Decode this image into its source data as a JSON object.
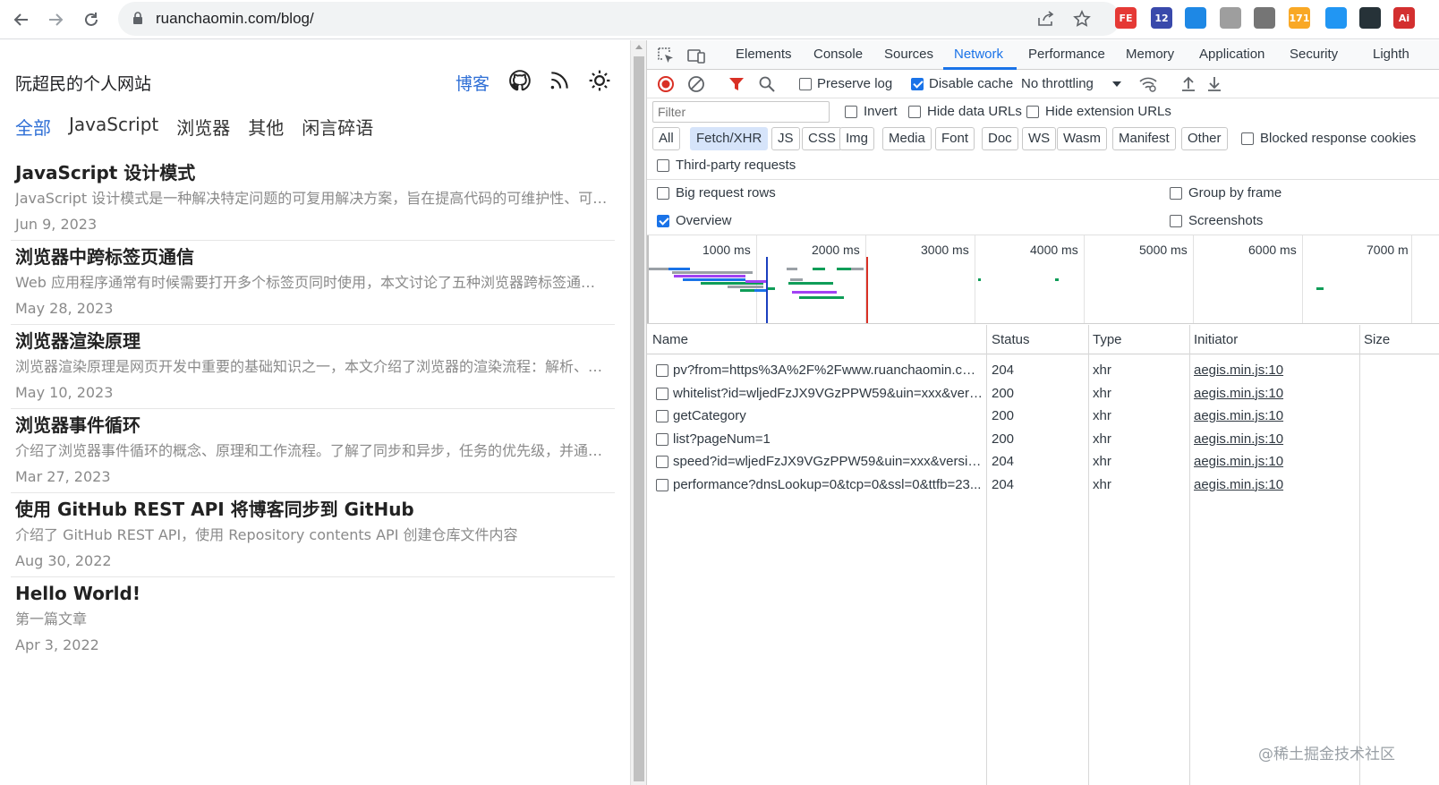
{
  "browser": {
    "url": "ruanchaomin.com/blog/",
    "extensions": [
      {
        "icon": "fe-extension-icon",
        "label": "FE",
        "color": "#e53935"
      },
      {
        "icon": "graduation-cap-extension-icon",
        "label": "12",
        "color": "#3949ab"
      },
      {
        "icon": "vue-devtools-extension-icon",
        "label": "",
        "color": "#1e88e5"
      },
      {
        "icon": "circle-extension-icon",
        "label": "",
        "color": "#9e9e9e"
      },
      {
        "icon": "v-extension-icon",
        "label": "",
        "color": "#757575"
      },
      {
        "icon": "rss-extension-icon",
        "label": "171",
        "color": "#f9a825"
      },
      {
        "icon": "stack-extension-icon",
        "label": "",
        "color": "#2196f3"
      },
      {
        "icon": "hexagon-extension-icon",
        "label": "",
        "color": "#263238"
      },
      {
        "icon": "ai-extension-icon",
        "label": "Ai",
        "color": "#d32f2f"
      }
    ]
  },
  "blog": {
    "site_title": "阮超民的个人网站",
    "nav_blog": "博客",
    "categories": [
      "全部",
      "JavaScript",
      "浏览器",
      "其他",
      "闲言碎语"
    ],
    "active_category": "全部",
    "posts": [
      {
        "title": "JavaScript 设计模式",
        "desc": "JavaScript 设计模式是一种解决特定问题的可复用解决方案，旨在提高代码的可维护性、可读...",
        "date": "Jun 9, 2023"
      },
      {
        "title": "浏览器中跨标签页通信",
        "desc": "Web 应用程序通常有时候需要打开多个标签页同时使用，本文讨论了五种浏览器跨标签通信方...",
        "date": "May 28, 2023"
      },
      {
        "title": "浏览器渲染原理",
        "desc": "浏览器渲染原理是网页开发中重要的基础知识之一，本文介绍了浏览器的渲染流程：解析、样...",
        "date": "May 10, 2023"
      },
      {
        "title": "浏览器事件循环",
        "desc": "介绍了浏览器事件循环的概念、原理和工作流程。了解了同步和异步，任务的优先级，并通过...",
        "date": "Mar 27, 2023"
      },
      {
        "title": "使用 GitHub REST API 将博客同步到 GitHub",
        "desc": "介绍了 GitHub REST API，使用 Repository contents API 创建仓库文件内容",
        "date": "Aug 30, 2022"
      },
      {
        "title": "Hello World!",
        "desc": "第一篇文章",
        "date": "Apr 3, 2022"
      }
    ]
  },
  "devtools": {
    "tabs": [
      "Elements",
      "Console",
      "Sources",
      "Network",
      "Performance",
      "Memory",
      "Application",
      "Security",
      "Lighth"
    ],
    "active_tab": "Network",
    "toolbar": {
      "preserve_log": "Preserve log",
      "disable_cache": "Disable cache",
      "throttling": "No throttling"
    },
    "filter": {
      "placeholder": "Filter",
      "invert": "Invert",
      "hide_data_urls": "Hide data URLs",
      "hide_extension_urls": "Hide extension URLs"
    },
    "types": [
      "All",
      "Fetch/XHR",
      "JS",
      "CSS",
      "Img",
      "Media",
      "Font",
      "Doc",
      "WS",
      "Wasm",
      "Manifest",
      "Other"
    ],
    "active_type": "Fetch/XHR",
    "blocked_cookies": "Blocked response cookies",
    "third_party": "Third-party requests",
    "big_request_rows": "Big request rows",
    "group_by_frame": "Group by frame",
    "overview_label": "Overview",
    "screenshots": "Screenshots",
    "timeline_labels": [
      "1000 ms",
      "2000 ms",
      "3000 ms",
      "4000 ms",
      "5000 ms",
      "6000 ms",
      "7000 m"
    ],
    "columns": [
      "Name",
      "Status",
      "Type",
      "Initiator",
      "Size"
    ],
    "requests": [
      {
        "name": "pv?from=https%3A%2F%2Fwww.ruanchaomin.com...",
        "status": "204",
        "type": "xhr",
        "initiator": "aegis.min.js:10"
      },
      {
        "name": "whitelist?id=wljedFzJX9VGzPPW59&uin=xxx&versio...",
        "status": "200",
        "type": "xhr",
        "initiator": "aegis.min.js:10"
      },
      {
        "name": "getCategory",
        "status": "200",
        "type": "xhr",
        "initiator": "aegis.min.js:10"
      },
      {
        "name": "list?pageNum=1",
        "status": "200",
        "type": "xhr",
        "initiator": "aegis.min.js:10"
      },
      {
        "name": "speed?id=wljedFzJX9VGzPPW59&uin=xxx&version...",
        "status": "204",
        "type": "xhr",
        "initiator": "aegis.min.js:10"
      },
      {
        "name": "performance?dnsLookup=0&tcp=0&ssl=0&ttfb=23...",
        "status": "204",
        "type": "xhr",
        "initiator": "aegis.min.js:10"
      }
    ]
  },
  "watermark": "@稀土掘金技术社区"
}
